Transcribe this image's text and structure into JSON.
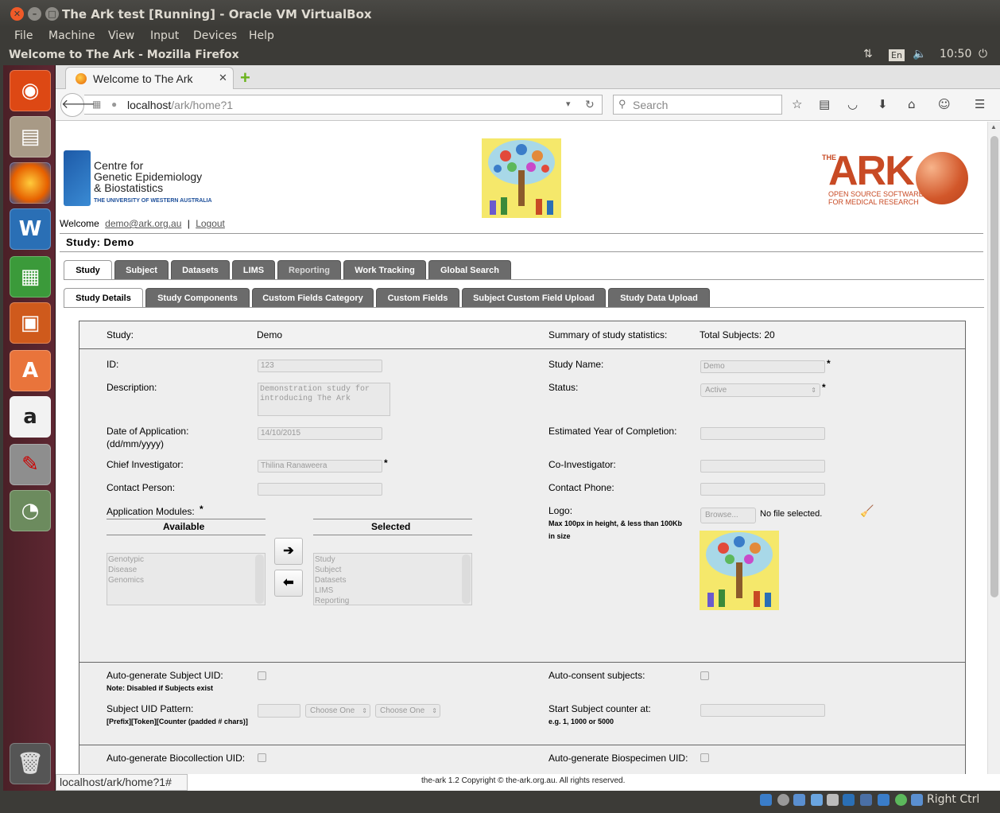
{
  "vbox": {
    "title": "The Ark test [Running] - Oracle VM VirtualBox",
    "menu": [
      "File",
      "Machine",
      "View",
      "Input",
      "Devices",
      "Help"
    ],
    "host_key": "Right Ctrl"
  },
  "guest_panel": {
    "window_title": "Welcome to The Ark - Mozilla Firefox",
    "keyboard": "En",
    "time": "10:50"
  },
  "launcher": {
    "icons": [
      "ubuntu-dash-icon",
      "files-icon",
      "firefox-icon",
      "writer-icon",
      "calc-icon",
      "impress-icon",
      "software-center-icon",
      "amazon-icon",
      "system-settings-icon",
      "disk-usage-icon",
      "trash-icon"
    ]
  },
  "firefox": {
    "tab_title": "Welcome to The Ark",
    "url_host": "localhost",
    "url_path": "/ark/home?1",
    "search_placeholder": "Search",
    "status_url": "localhost/ark/home?1#"
  },
  "header": {
    "cgeb_line1": "Centre for",
    "cgeb_line2": "Genetic Epidemiology",
    "cgeb_line3": "& Biostatistics",
    "cgeb_sub": "THE UNIVERSITY OF WESTERN AUSTRALIA",
    "ark_the": "THE",
    "ark_word": "ARK",
    "ark_tag1": "OPEN SOURCE SOFTWARE",
    "ark_tag2": "FOR MEDICAL RESEARCH",
    "welcome": "Welcome",
    "user_email": "demo@ark.org.au",
    "separator": "|",
    "logout": "Logout",
    "study_title": "Study: Demo"
  },
  "main_tabs": [
    "Study",
    "Subject",
    "Datasets",
    "LIMS",
    "Reporting",
    "Work Tracking",
    "Global Search"
  ],
  "sub_tabs": [
    "Study Details",
    "Study Components",
    "Custom Fields Category",
    "Custom Fields",
    "Subject Custom Field Upload",
    "Study Data Upload"
  ],
  "form": {
    "study_label": "Study:",
    "study_value": "Demo",
    "summary_label": "Summary of study statistics:",
    "summary_value": "Total Subjects: 20",
    "id_label": "ID:",
    "id_value": "123",
    "study_name_label": "Study Name:",
    "study_name_value": "Demo",
    "description_label": "Description:",
    "description_line1": "Demonstration study for",
    "description_line2": "introducing The Ark",
    "status_label": "Status:",
    "status_value": "Active",
    "date_label_1": "Date of Application:",
    "date_label_2": "(dd/mm/yyyy)",
    "date_value": "14/10/2015",
    "est_year_label": "Estimated Year of Completion:",
    "chief_label": "Chief Investigator:",
    "chief_value": "Thilina Ranaweera",
    "co_label": "Co-Investigator:",
    "contact_person_label": "Contact Person:",
    "contact_phone_label": "Contact Phone:",
    "modules_label": "Application Modules:",
    "available_header": "Available",
    "selected_header": "Selected",
    "available_items": [
      "Genotypic",
      "Disease",
      "Genomics"
    ],
    "selected_items": [
      "Study",
      "Subject",
      "Datasets",
      "LIMS",
      "Reporting"
    ],
    "move_right": "➔",
    "move_left": "⬅",
    "logo_label": "Logo:",
    "logo_note_1": "Max 100px in height, & less than 100Kb",
    "logo_note_2": "in size",
    "browse_button": "Browse...",
    "no_file": "No file selected.",
    "required_star": "*",
    "auto_uid_label": "Auto-generate Subject UID:",
    "auto_uid_note": "Note: Disabled if Subjects exist",
    "auto_consent_label": "Auto-consent subjects:",
    "uid_pattern_label": "Subject UID Pattern:",
    "uid_pattern_note": "[Prefix][Token][Counter (padded # chars)]",
    "choose_one_1": "Choose One",
    "choose_one_2": "Choose One",
    "start_counter_label": "Start Subject counter at:",
    "start_counter_note": "e.g. 1, 1000 or 5000",
    "auto_bio_label": "Auto-generate Biocollection UID:",
    "auto_biospec_label": "Auto-generate Biospecimen UID:"
  },
  "footer": "the-ark 1.2 Copyright © the-ark.org.au. All rights reserved."
}
